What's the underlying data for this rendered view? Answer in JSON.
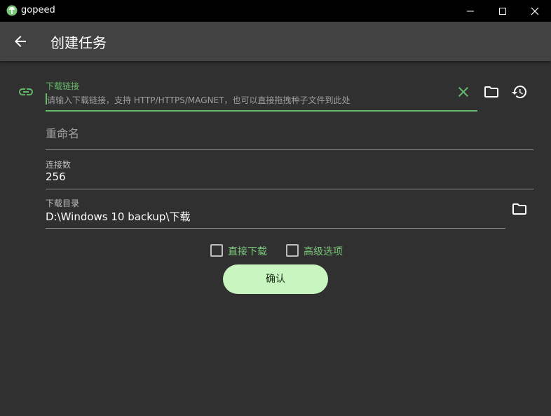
{
  "window": {
    "app_name": "gopeed"
  },
  "appbar": {
    "title": "创建任务"
  },
  "form": {
    "url": {
      "label": "下载链接",
      "placeholder": "请输入下载链接，支持 HTTP/HTTPS/MAGNET，也可以直接拖拽种子文件到此处"
    },
    "rename": {
      "placeholder": "重命名"
    },
    "connections": {
      "label": "连接数",
      "value": "256"
    },
    "directory": {
      "label": "下载目录",
      "value": "D:\\Windows 10 backup\\下载"
    }
  },
  "options": {
    "direct_download": "直接下载",
    "advanced": "高级选项"
  },
  "actions": {
    "confirm": "确认"
  },
  "colors": {
    "accent": "#66bb6a",
    "button": "#c8f5c0",
    "background": "#303030",
    "appbar": "#424242"
  }
}
